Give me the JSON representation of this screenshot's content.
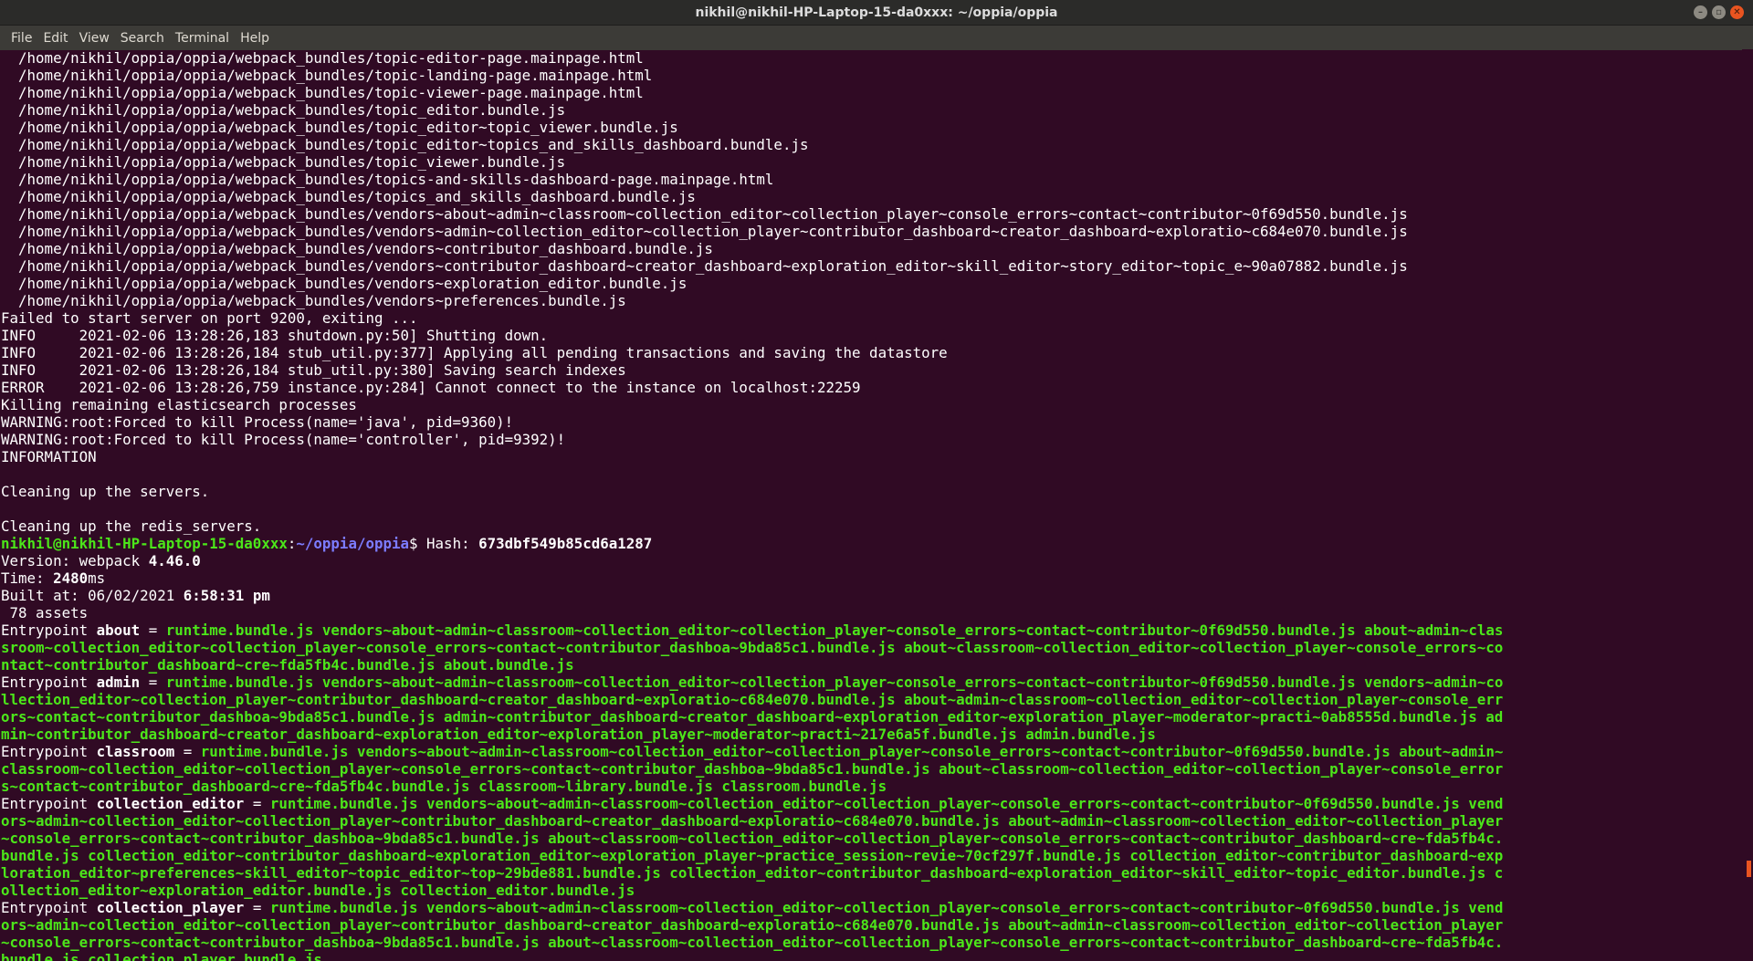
{
  "window": {
    "title": "nikhil@nikhil-HP-Laptop-15-da0xxx: ~/oppia/oppia"
  },
  "menu": [
    "File",
    "Edit",
    "View",
    "Search",
    "Terminal",
    "Help"
  ],
  "colors": {
    "background": "#300a24",
    "text": "#ffffff",
    "green": "#4ce61a",
    "prompt_path": "#7c7cff",
    "scrollbar_thumb": "#e95420"
  },
  "terminal": {
    "lines": [
      {
        "segments": [
          {
            "text": "  /home/nikhil/oppia/oppia/webpack_bundles/topic-editor-page.mainpage.html"
          }
        ]
      },
      {
        "segments": [
          {
            "text": "  /home/nikhil/oppia/oppia/webpack_bundles/topic-landing-page.mainpage.html"
          }
        ]
      },
      {
        "segments": [
          {
            "text": "  /home/nikhil/oppia/oppia/webpack_bundles/topic-viewer-page.mainpage.html"
          }
        ]
      },
      {
        "segments": [
          {
            "text": "  /home/nikhil/oppia/oppia/webpack_bundles/topic_editor.bundle.js"
          }
        ]
      },
      {
        "segments": [
          {
            "text": "  /home/nikhil/oppia/oppia/webpack_bundles/topic_editor~topic_viewer.bundle.js"
          }
        ]
      },
      {
        "segments": [
          {
            "text": "  /home/nikhil/oppia/oppia/webpack_bundles/topic_editor~topics_and_skills_dashboard.bundle.js"
          }
        ]
      },
      {
        "segments": [
          {
            "text": "  /home/nikhil/oppia/oppia/webpack_bundles/topic_viewer.bundle.js"
          }
        ]
      },
      {
        "segments": [
          {
            "text": "  /home/nikhil/oppia/oppia/webpack_bundles/topics-and-skills-dashboard-page.mainpage.html"
          }
        ]
      },
      {
        "segments": [
          {
            "text": "  /home/nikhil/oppia/oppia/webpack_bundles/topics_and_skills_dashboard.bundle.js"
          }
        ]
      },
      {
        "segments": [
          {
            "text": "  /home/nikhil/oppia/oppia/webpack_bundles/vendors~about~admin~classroom~collection_editor~collection_player~console_errors~contact~contributor~0f69d550.bundle.js"
          }
        ]
      },
      {
        "segments": [
          {
            "text": "  /home/nikhil/oppia/oppia/webpack_bundles/vendors~admin~collection_editor~collection_player~contributor_dashboard~creator_dashboard~exploratio~c684e070.bundle.js"
          }
        ]
      },
      {
        "segments": [
          {
            "text": "  /home/nikhil/oppia/oppia/webpack_bundles/vendors~contributor_dashboard.bundle.js"
          }
        ]
      },
      {
        "segments": [
          {
            "text": "  /home/nikhil/oppia/oppia/webpack_bundles/vendors~contributor_dashboard~creator_dashboard~exploration_editor~skill_editor~story_editor~topic_e~90a07882.bundle.js"
          }
        ]
      },
      {
        "segments": [
          {
            "text": "  /home/nikhil/oppia/oppia/webpack_bundles/vendors~exploration_editor.bundle.js"
          }
        ]
      },
      {
        "segments": [
          {
            "text": "  /home/nikhil/oppia/oppia/webpack_bundles/vendors~preferences.bundle.js"
          }
        ]
      },
      {
        "segments": [
          {
            "text": "Failed to start server on port 9200, exiting ..."
          }
        ]
      },
      {
        "segments": [
          {
            "text": "INFO     2021-02-06 13:28:26,183 shutdown.py:50] Shutting down."
          }
        ]
      },
      {
        "segments": [
          {
            "text": "INFO     2021-02-06 13:28:26,184 stub_util.py:377] Applying all pending transactions and saving the datastore"
          }
        ]
      },
      {
        "segments": [
          {
            "text": "INFO     2021-02-06 13:28:26,184 stub_util.py:380] Saving search indexes"
          }
        ]
      },
      {
        "segments": [
          {
            "text": "ERROR    2021-02-06 13:28:26,759 instance.py:284] Cannot connect to the instance on localhost:22259"
          }
        ]
      },
      {
        "segments": [
          {
            "text": "Killing remaining elasticsearch processes"
          }
        ]
      },
      {
        "segments": [
          {
            "text": "WARNING:root:Forced to kill Process(name='java', pid=9360)!"
          }
        ]
      },
      {
        "segments": [
          {
            "text": "WARNING:root:Forced to kill Process(name='controller', pid=9392)!"
          }
        ]
      },
      {
        "segments": [
          {
            "text": "INFORMATION"
          }
        ]
      },
      {
        "segments": [
          {
            "text": ""
          }
        ]
      },
      {
        "segments": [
          {
            "text": "Cleaning up the servers."
          }
        ]
      },
      {
        "segments": [
          {
            "text": ""
          }
        ]
      },
      {
        "segments": [
          {
            "text": "Cleaning up the redis_servers."
          }
        ]
      },
      {
        "segments": [
          {
            "text": "nikhil@nikhil-HP-Laptop-15-da0xxx",
            "style": "g"
          },
          {
            "text": ":"
          },
          {
            "text": "~/oppia/oppia",
            "style": "b"
          },
          {
            "text": "$ Hash: "
          },
          {
            "text": "673dbf549b85cd6a1287",
            "style": "w"
          }
        ]
      },
      {
        "segments": [
          {
            "text": "Version: webpack "
          },
          {
            "text": "4.46.0",
            "style": "w"
          }
        ]
      },
      {
        "segments": [
          {
            "text": "Time: "
          },
          {
            "text": "2480",
            "style": "w"
          },
          {
            "text": "ms"
          }
        ]
      },
      {
        "segments": [
          {
            "text": "Built at: 06/02/2021 "
          },
          {
            "text": "6:58:31 pm",
            "style": "w"
          }
        ]
      },
      {
        "segments": [
          {
            "text": " 78 assets"
          }
        ]
      },
      {
        "segments": [
          {
            "text": "Entrypoint "
          },
          {
            "text": "about",
            "style": "w"
          },
          {
            "text": " = "
          },
          {
            "text": "runtime.bundle.js vendors~about~admin~classroom~collection_editor~collection_player~console_errors~contact~contributor~0f69d550.bundle.js about~admin~clas",
            "style": "g"
          }
        ]
      },
      {
        "segments": [
          {
            "text": "sroom~collection_editor~collection_player~console_errors~contact~contributor_dashboa~9bda85c1.bundle.js about~classroom~collection_editor~collection_player~console_errors~co",
            "style": "g"
          }
        ]
      },
      {
        "segments": [
          {
            "text": "ntact~contributor_dashboard~cre~fda5fb4c.bundle.js about.bundle.js",
            "style": "g"
          }
        ]
      },
      {
        "segments": [
          {
            "text": "Entrypoint "
          },
          {
            "text": "admin",
            "style": "w"
          },
          {
            "text": " = "
          },
          {
            "text": "runtime.bundle.js vendors~about~admin~classroom~collection_editor~collection_player~console_errors~contact~contributor~0f69d550.bundle.js vendors~admin~co",
            "style": "g"
          }
        ]
      },
      {
        "segments": [
          {
            "text": "llection_editor~collection_player~contributor_dashboard~creator_dashboard~exploratio~c684e070.bundle.js about~admin~classroom~collection_editor~collection_player~console_err",
            "style": "g"
          }
        ]
      },
      {
        "segments": [
          {
            "text": "ors~contact~contributor_dashboa~9bda85c1.bundle.js admin~contributor_dashboard~creator_dashboard~exploration_editor~exploration_player~moderator~practi~0ab8555d.bundle.js ad",
            "style": "g"
          }
        ]
      },
      {
        "segments": [
          {
            "text": "min~contributor_dashboard~creator_dashboard~exploration_editor~exploration_player~moderator~practi~217e6a5f.bundle.js admin.bundle.js",
            "style": "g"
          }
        ]
      },
      {
        "segments": [
          {
            "text": "Entrypoint "
          },
          {
            "text": "classroom",
            "style": "w"
          },
          {
            "text": " = "
          },
          {
            "text": "runtime.bundle.js vendors~about~admin~classroom~collection_editor~collection_player~console_errors~contact~contributor~0f69d550.bundle.js about~admin~",
            "style": "g"
          }
        ]
      },
      {
        "segments": [
          {
            "text": "classroom~collection_editor~collection_player~console_errors~contact~contributor_dashboa~9bda85c1.bundle.js about~classroom~collection_editor~collection_player~console_error",
            "style": "g"
          }
        ]
      },
      {
        "segments": [
          {
            "text": "s~contact~contributor_dashboard~cre~fda5fb4c.bundle.js classroom~library.bundle.js classroom.bundle.js",
            "style": "g"
          }
        ]
      },
      {
        "segments": [
          {
            "text": "Entrypoint "
          },
          {
            "text": "collection_editor",
            "style": "w"
          },
          {
            "text": " = "
          },
          {
            "text": "runtime.bundle.js vendors~about~admin~classroom~collection_editor~collection_player~console_errors~contact~contributor~0f69d550.bundle.js vend",
            "style": "g"
          }
        ]
      },
      {
        "segments": [
          {
            "text": "ors~admin~collection_editor~collection_player~contributor_dashboard~creator_dashboard~exploratio~c684e070.bundle.js about~admin~classroom~collection_editor~collection_player",
            "style": "g"
          }
        ]
      },
      {
        "segments": [
          {
            "text": "~console_errors~contact~contributor_dashboa~9bda85c1.bundle.js about~classroom~collection_editor~collection_player~console_errors~contact~contributor_dashboard~cre~fda5fb4c.",
            "style": "g"
          }
        ]
      },
      {
        "segments": [
          {
            "text": "bundle.js collection_editor~contributor_dashboard~exploration_editor~exploration_player~practice_session~revie~70cf297f.bundle.js collection_editor~contributor_dashboard~exp",
            "style": "g"
          }
        ]
      },
      {
        "segments": [
          {
            "text": "loration_editor~preferences~skill_editor~topic_editor~top~29bde881.bundle.js collection_editor~contributor_dashboard~exploration_editor~skill_editor~topic_editor.bundle.js c",
            "style": "g"
          }
        ]
      },
      {
        "segments": [
          {
            "text": "ollection_editor~exploration_editor.bundle.js collection_editor.bundle.js",
            "style": "g"
          }
        ]
      },
      {
        "segments": [
          {
            "text": "Entrypoint "
          },
          {
            "text": "collection_player",
            "style": "w"
          },
          {
            "text": " = "
          },
          {
            "text": "runtime.bundle.js vendors~about~admin~classroom~collection_editor~collection_player~console_errors~contact~contributor~0f69d550.bundle.js vend",
            "style": "g"
          }
        ]
      },
      {
        "segments": [
          {
            "text": "ors~admin~collection_editor~collection_player~contributor_dashboard~creator_dashboard~exploratio~c684e070.bundle.js about~admin~classroom~collection_editor~collection_player",
            "style": "g"
          }
        ]
      },
      {
        "segments": [
          {
            "text": "~console_errors~contact~contributor_dashboa~9bda85c1.bundle.js about~classroom~collection_editor~collection_player~console_errors~contact~contributor_dashboard~cre~fda5fb4c.",
            "style": "g"
          }
        ]
      },
      {
        "segments": [
          {
            "text": "bundle.js collection_player.bundle.js",
            "style": "g"
          }
        ]
      }
    ]
  }
}
